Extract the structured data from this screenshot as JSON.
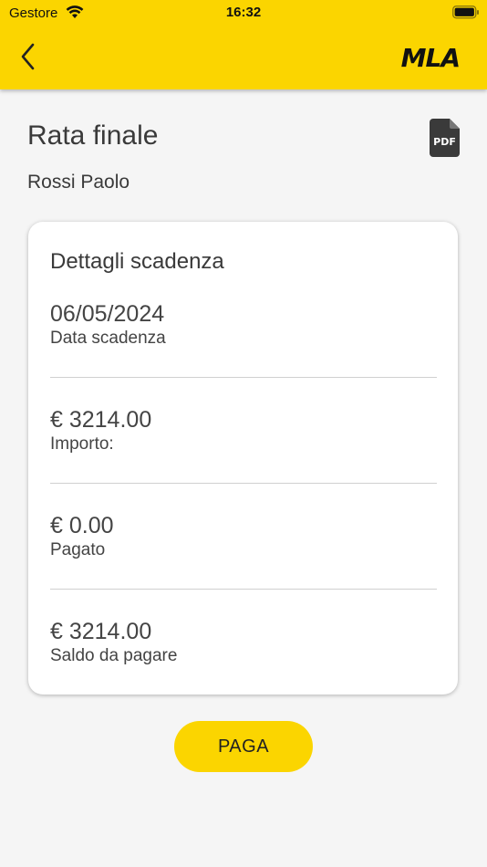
{
  "status_bar": {
    "carrier": "Gestore",
    "time": "16:32"
  },
  "header": {
    "logo": "MLA",
    "back_icon": "chevron-left-icon",
    "accent_color": "#fbd500"
  },
  "page": {
    "title": "Rata finale",
    "subtitle": "Rossi Paolo",
    "pdf_icon": "pdf-icon",
    "pdf_icon_text": "PDF"
  },
  "card": {
    "title": "Dettagli scadenza",
    "rows": [
      {
        "value": "06/05/2024",
        "label": "Data scadenza"
      },
      {
        "value": "€ 3214.00",
        "label": "Importo:"
      },
      {
        "value": "€ 0.00",
        "label": "Pagato"
      },
      {
        "value": "€ 3214.00",
        "label": "Saldo da pagare"
      }
    ]
  },
  "actions": {
    "pay_label": "PAGA"
  }
}
